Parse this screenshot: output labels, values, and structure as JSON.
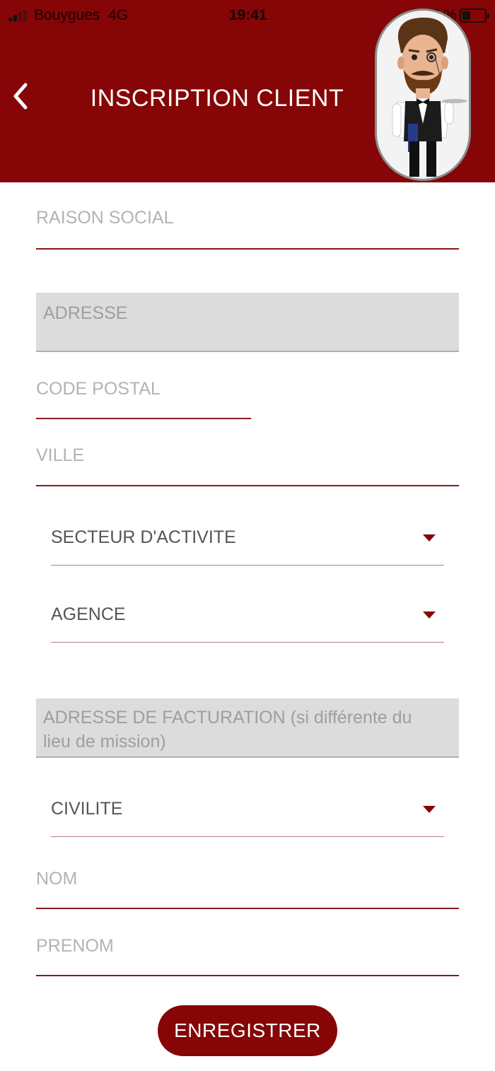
{
  "status_bar": {
    "carrier": "Bouygues",
    "network": "4G",
    "time": "19:41",
    "battery": "37 %"
  },
  "header": {
    "title": "INSCRIPTION CLIENT",
    "back_icon": "chevron-left-icon",
    "avatar_icon": "waiter-mascot-icon",
    "background": "#860506"
  },
  "form": {
    "raison_social": "RAISON SOCIAL",
    "adresse": "ADRESSE",
    "code_postal": "CODE POSTAL",
    "ville": "VILLE",
    "secteur": "SECTEUR D'ACTIVITE",
    "agence": "AGENCE",
    "adresse_facturation": "ADRESSE DE FACTURATION (si différente du lieu de mission)",
    "civilite": "CIVILITE",
    "nom": "NOM",
    "prenom": "PRENOM"
  },
  "submit_label": "ENREGISTRER"
}
